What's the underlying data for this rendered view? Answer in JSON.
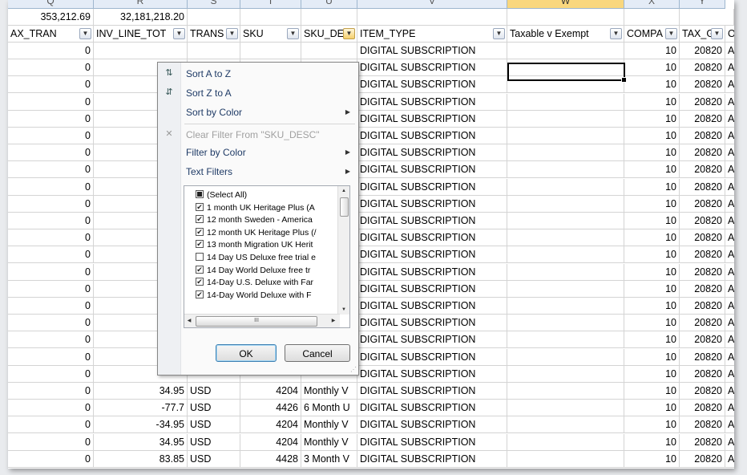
{
  "columns": [
    "Q",
    "R",
    "S",
    "T",
    "U",
    "V",
    "W",
    "X",
    "Y"
  ],
  "selected_column": "W",
  "totals": {
    "q": "353,212.69",
    "r": "32,181,218.20"
  },
  "headers": [
    "AX_TRAN",
    "INV_LINE_TOT",
    "TRANS",
    "SKU",
    "SKU_DE",
    "ITEM_TYPE",
    "Taxable v Exempt",
    "COMPA",
    "TAX_GL",
    "O"
  ],
  "rows": [
    {
      "q": "0",
      "r": "",
      "s": "",
      "t": "",
      "u": "",
      "v": "DIGITAL SUBSCRIPTION",
      "x": "10",
      "y": "20820",
      "z": "AI"
    },
    {
      "q": "0",
      "r": "",
      "s": "",
      "t": "",
      "u": "",
      "v": "DIGITAL SUBSCRIPTION",
      "x": "10",
      "y": "20820",
      "z": "AI"
    },
    {
      "q": "0",
      "r": "",
      "s": "",
      "t": "",
      "u": "",
      "v": "DIGITAL SUBSCRIPTION",
      "x": "10",
      "y": "20820",
      "z": "AI"
    },
    {
      "q": "0",
      "r": "",
      "s": "",
      "t": "",
      "u": "",
      "v": "DIGITAL SUBSCRIPTION",
      "x": "10",
      "y": "20820",
      "z": "AI"
    },
    {
      "q": "0",
      "r": "",
      "s": "",
      "t": "",
      "u": "",
      "v": "DIGITAL SUBSCRIPTION",
      "x": "10",
      "y": "20820",
      "z": "AI"
    },
    {
      "q": "0",
      "r": "",
      "s": "",
      "t": "",
      "u": "",
      "v": "DIGITAL SUBSCRIPTION",
      "x": "10",
      "y": "20820",
      "z": "AI"
    },
    {
      "q": "0",
      "r": "",
      "s": "",
      "t": "",
      "u": "",
      "v": "DIGITAL SUBSCRIPTION",
      "x": "10",
      "y": "20820",
      "z": "AI"
    },
    {
      "q": "0",
      "r": "",
      "s": "",
      "t": "",
      "u": "",
      "v": "DIGITAL SUBSCRIPTION",
      "x": "10",
      "y": "20820",
      "z": "AI"
    },
    {
      "q": "0",
      "r": "",
      "s": "",
      "t": "",
      "u": "",
      "v": "DIGITAL SUBSCRIPTION",
      "x": "10",
      "y": "20820",
      "z": "AI"
    },
    {
      "q": "0",
      "r": "",
      "s": "",
      "t": "",
      "u": "",
      "v": "DIGITAL SUBSCRIPTION",
      "x": "10",
      "y": "20820",
      "z": "AI"
    },
    {
      "q": "0",
      "r": "",
      "s": "",
      "t": "",
      "u": "",
      "v": "DIGITAL SUBSCRIPTION",
      "x": "10",
      "y": "20820",
      "z": "AI"
    },
    {
      "q": "0",
      "r": "",
      "s": "",
      "t": "",
      "u": "",
      "v": "DIGITAL SUBSCRIPTION",
      "x": "10",
      "y": "20820",
      "z": "AI"
    },
    {
      "q": "0",
      "r": "",
      "s": "",
      "t": "",
      "u": "",
      "v": "DIGITAL SUBSCRIPTION",
      "x": "10",
      "y": "20820",
      "z": "AI"
    },
    {
      "q": "0",
      "r": "",
      "s": "",
      "t": "",
      "u": "",
      "v": "DIGITAL SUBSCRIPTION",
      "x": "10",
      "y": "20820",
      "z": "AI"
    },
    {
      "q": "0",
      "r": "",
      "s": "",
      "t": "",
      "u": "",
      "v": "DIGITAL SUBSCRIPTION",
      "x": "10",
      "y": "20820",
      "z": "AI"
    },
    {
      "q": "0",
      "r": "",
      "s": "",
      "t": "",
      "u": "",
      "v": "DIGITAL SUBSCRIPTION",
      "x": "10",
      "y": "20820",
      "z": "AI"
    },
    {
      "q": "0",
      "r": "",
      "s": "",
      "t": "",
      "u": "",
      "v": "DIGITAL SUBSCRIPTION",
      "x": "10",
      "y": "20820",
      "z": "AI"
    },
    {
      "q": "0",
      "r": "",
      "s": "",
      "t": "",
      "u": "",
      "v": "DIGITAL SUBSCRIPTION",
      "x": "10",
      "y": "20820",
      "z": "AI"
    },
    {
      "q": "0",
      "r": "",
      "s": "",
      "t": "",
      "u": "",
      "v": "DIGITAL SUBSCRIPTION",
      "x": "10",
      "y": "20820",
      "z": "AI"
    },
    {
      "q": "0",
      "r": "",
      "s": "",
      "t": "",
      "u": "",
      "v": "DIGITAL SUBSCRIPTION",
      "x": "10",
      "y": "20820",
      "z": "AI"
    },
    {
      "q": "0",
      "r": "34.95",
      "s": "USD",
      "t": "4204",
      "u": "Monthly V",
      "v": "DIGITAL SUBSCRIPTION",
      "x": "10",
      "y": "20820",
      "z": "AI"
    },
    {
      "q": "0",
      "r": "-77.7",
      "s": "USD",
      "t": "4426",
      "u": "6 Month U",
      "v": "DIGITAL SUBSCRIPTION",
      "x": "10",
      "y": "20820",
      "z": "AI"
    },
    {
      "q": "0",
      "r": "-34.95",
      "s": "USD",
      "t": "4204",
      "u": "Monthly V",
      "v": "DIGITAL SUBSCRIPTION",
      "x": "10",
      "y": "20820",
      "z": "AI"
    },
    {
      "q": "0",
      "r": "34.95",
      "s": "USD",
      "t": "4204",
      "u": "Monthly V",
      "v": "DIGITAL SUBSCRIPTION",
      "x": "10",
      "y": "20820",
      "z": "AI"
    },
    {
      "q": "0",
      "r": "83.85",
      "s": "USD",
      "t": "4428",
      "u": "3 Month V",
      "v": "DIGITAL SUBSCRIPTION",
      "x": "10",
      "y": "20820",
      "z": "AI"
    }
  ],
  "filter_menu": {
    "sort_az": "Sort A to Z",
    "sort_za": "Sort Z to A",
    "sort_color": "Sort by Color",
    "clear_filter": "Clear Filter From \"SKU_DESC\"",
    "filter_color": "Filter by Color",
    "text_filters": "Text Filters",
    "ok": "OK",
    "cancel": "Cancel",
    "hscroll_label": "III",
    "items": [
      {
        "label": "(Select All)",
        "state": "partial"
      },
      {
        "label": "1 month UK Heritage Plus (A",
        "state": "checked"
      },
      {
        "label": "12 month Sweden - America",
        "state": "checked"
      },
      {
        "label": "12 month UK Heritage Plus (/",
        "state": "checked"
      },
      {
        "label": "13 month Migration UK Herit",
        "state": "checked"
      },
      {
        "label": "14 Day US Deluxe free trial e",
        "state": "unchecked"
      },
      {
        "label": "14 Day World Deluxe free tr",
        "state": "checked"
      },
      {
        "label": "14-Day U.S. Deluxe with Far",
        "state": "checked"
      },
      {
        "label": "14-Day World Deluxe with F",
        "state": "checked"
      }
    ]
  },
  "icons": {
    "sort_az": "A-Z sort icon",
    "sort_za": "Z-A sort icon",
    "clear": "funnel clear icon"
  }
}
